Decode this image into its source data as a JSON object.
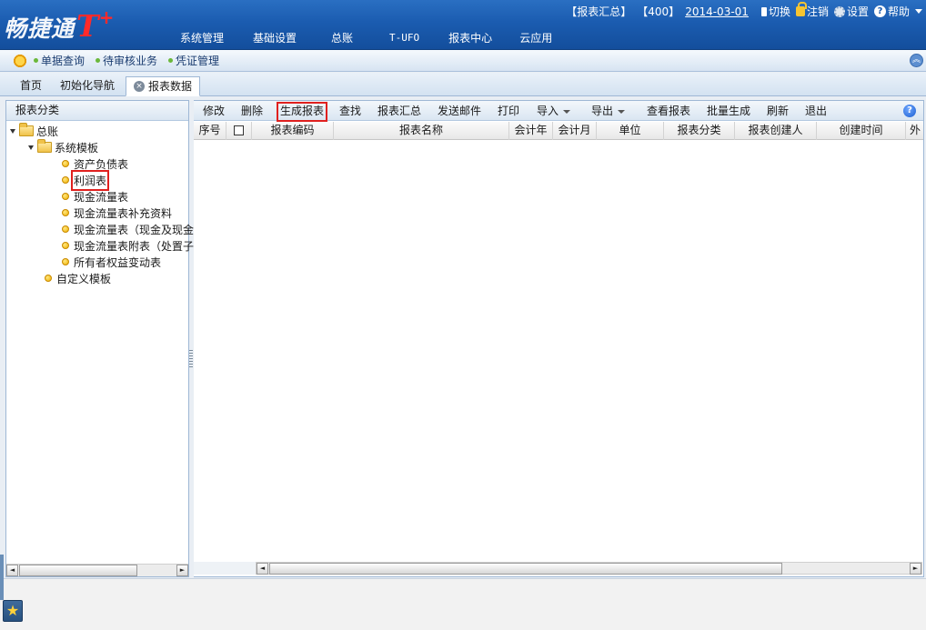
{
  "app": {
    "logo_text": "畅捷通",
    "logo_brand": "T",
    "logo_plus": "+"
  },
  "header": {
    "report_sum": "【报表汇总】",
    "account_code": "【400】",
    "date": "2014-03-01",
    "switch_label": "切换",
    "logout_label": "注销",
    "settings_label": "设置",
    "help_label": "帮助",
    "help_glyph": "?",
    "nav": [
      "系统管理",
      "基础设置",
      "总账",
      "T-UFO",
      "报表中心",
      "云应用"
    ]
  },
  "quickbar": {
    "items": [
      "单据查询",
      "待审核业务",
      "凭证管理"
    ],
    "collapse_glyph": "︽"
  },
  "tabs": {
    "home": "首页",
    "init": "初始化导航",
    "active": "报表数据",
    "close_glyph": "×"
  },
  "left_panel": {
    "title": "报表分类",
    "tree": {
      "root": "总账",
      "system_templates": "系统模板",
      "leaves": [
        "资产负债表",
        "利润表",
        "现金流量表",
        "现金流量表补充资料",
        "现金流量表（现金及现金",
        "现金流量表附表（处置子",
        "所有者权益变动表"
      ],
      "custom": "自定义模板"
    },
    "scroll_left": "◄",
    "scroll_right": "►"
  },
  "toolbar": {
    "edit": "修改",
    "delete": "删除",
    "generate": "生成报表",
    "find": "查找",
    "summary": "报表汇总",
    "send_mail": "发送邮件",
    "print": "打印",
    "import": "导入",
    "export": "导出",
    "view": "查看报表",
    "batch": "批量生成",
    "refresh": "刷新",
    "exit": "退出",
    "help_glyph": "?"
  },
  "grid": {
    "columns": [
      "序号",
      "",
      "报表编码",
      "报表名称",
      "会计年",
      "会计月",
      "单位",
      "报表分类",
      "报表创建人",
      "创建时间",
      "外"
    ]
  },
  "bottom": {
    "star_glyph": "★"
  },
  "colors": {
    "header_blue": "#1b5cb0",
    "highlight_red": "#e0201e",
    "logo_red": "#ff2a2a"
  }
}
